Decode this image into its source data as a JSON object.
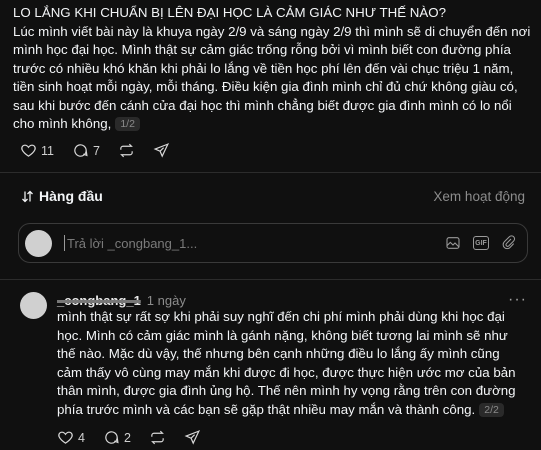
{
  "post": {
    "title_line": "LO LẮNG KHI CHUẨN BỊ LÊN ĐẠI HỌC LÀ CẢM GIÁC NHƯ THẾ NÀO?",
    "body": "Lúc mình viết bài này là khuya ngày 2/9 và sáng ngày 2/9 thì mình sẽ di chuyển đến nơi mình học đại học. Mình thật sự cảm giác trống rỗng bởi vì mình biết con đường phía trước có nhiều khó khăn khi phải lo lắng về tiền học phí lên đến vài chục triệu 1 năm, tiền sinh hoạt mỗi ngày, mỗi tháng. Điều kiện gia đình mình chỉ đủ chứ không giàu có, sau khi bước đến cánh cửa đại học thì mình chẳng biết được gia đình mình có lo nổi cho mình không,",
    "pager": "1/2",
    "likes": "11",
    "comments": "7"
  },
  "sort": {
    "label": "Hàng đầu",
    "view_activity": "Xem hoạt động"
  },
  "reply": {
    "placeholder": "Trả lời _congbang_1..."
  },
  "comment": {
    "username": "_congbang_1",
    "time": "1 ngày",
    "body": "mình thật sự rất sợ khi phải suy nghĩ đến chi phí mình phải dùng khi học đại học. Mình có cảm giác mình là gánh nặng, không biết tương lai mình sẽ như thế nào. Mặc dù vậy, thế nhưng bên cạnh những điều lo lắng ấy mình cũng cảm thấy vô cùng may mắn khi được đi học, được thực hiện ước mơ của bản thân mình, được gia đình ủng hộ. Thế nên mình hy vọng rằng trên con đường phía trước mình và các bạn sẽ gặp thật nhiều may mắn và thành công.",
    "pager": "2/2",
    "likes": "4",
    "replies": "2",
    "more": "···"
  },
  "colors": {
    "background": "#101010",
    "text": "#f3f5f7",
    "muted": "#8c8c8c",
    "divider": "#2c2c2c"
  }
}
